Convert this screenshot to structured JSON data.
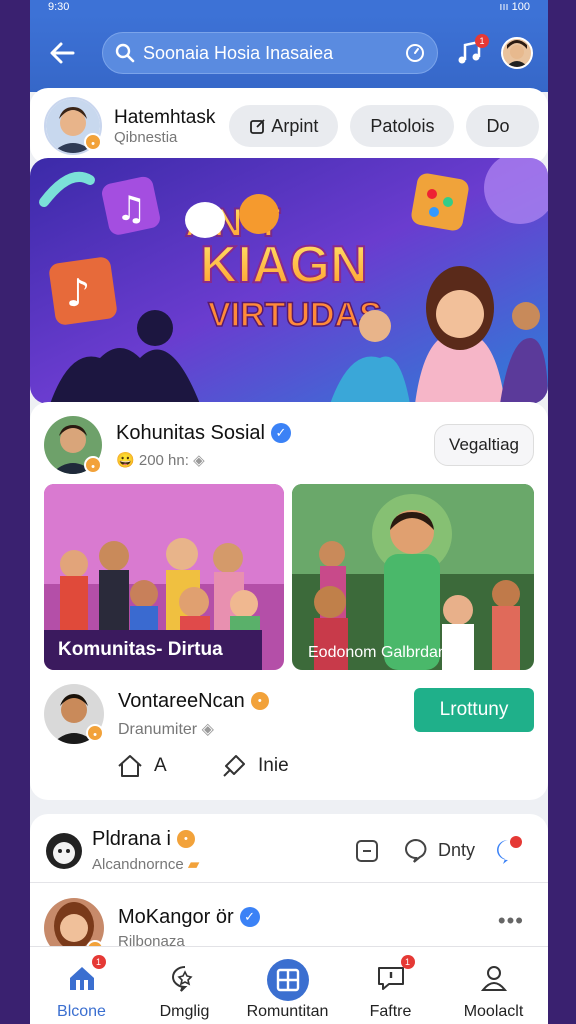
{
  "statusbar": {
    "time": "9:30",
    "signal": "ııı",
    "battery": "100"
  },
  "header": {
    "search_placeholder": "Soonaia Hosia Inasaiea",
    "music_badge": "1"
  },
  "stories": {
    "user_name": "Hatemhtask",
    "user_sub": "Qibnestia",
    "chips": [
      "Arpint",
      "Patolois",
      "Do"
    ]
  },
  "banner": {
    "line1": "AN-T",
    "line2": "KIAGN",
    "line3": "VIRTUDAS"
  },
  "post": {
    "author": "Kohunitas Sosial",
    "meta": "200 hn:",
    "follow_label": "Vegaltiag",
    "image1_caption": "Komunitas- Dirtua",
    "image2_caption": "Eodonom Galbrdan",
    "commenter_name": "VontareeNcan",
    "commenter_sub": "Dranumiter",
    "join_label": "Lrottuny",
    "action1_label": "A",
    "action2_label": "Inie"
  },
  "feed": [
    {
      "name": "Pldrana i",
      "sub": "Alcandnornce",
      "action_label": "Dnty"
    },
    {
      "name": "MoKangor ör",
      "sub": "Rilbonaza"
    }
  ],
  "tabbar": [
    {
      "label": "Blcone",
      "badge": "1"
    },
    {
      "label": "Dmglig"
    },
    {
      "label": "Romuntitan"
    },
    {
      "label": "Faftre",
      "badge": "1"
    },
    {
      "label": "Moolaclt"
    }
  ],
  "colors": {
    "primary": "#3d72d6",
    "accent_green": "#1fb08a",
    "badge_red": "#e53935"
  }
}
